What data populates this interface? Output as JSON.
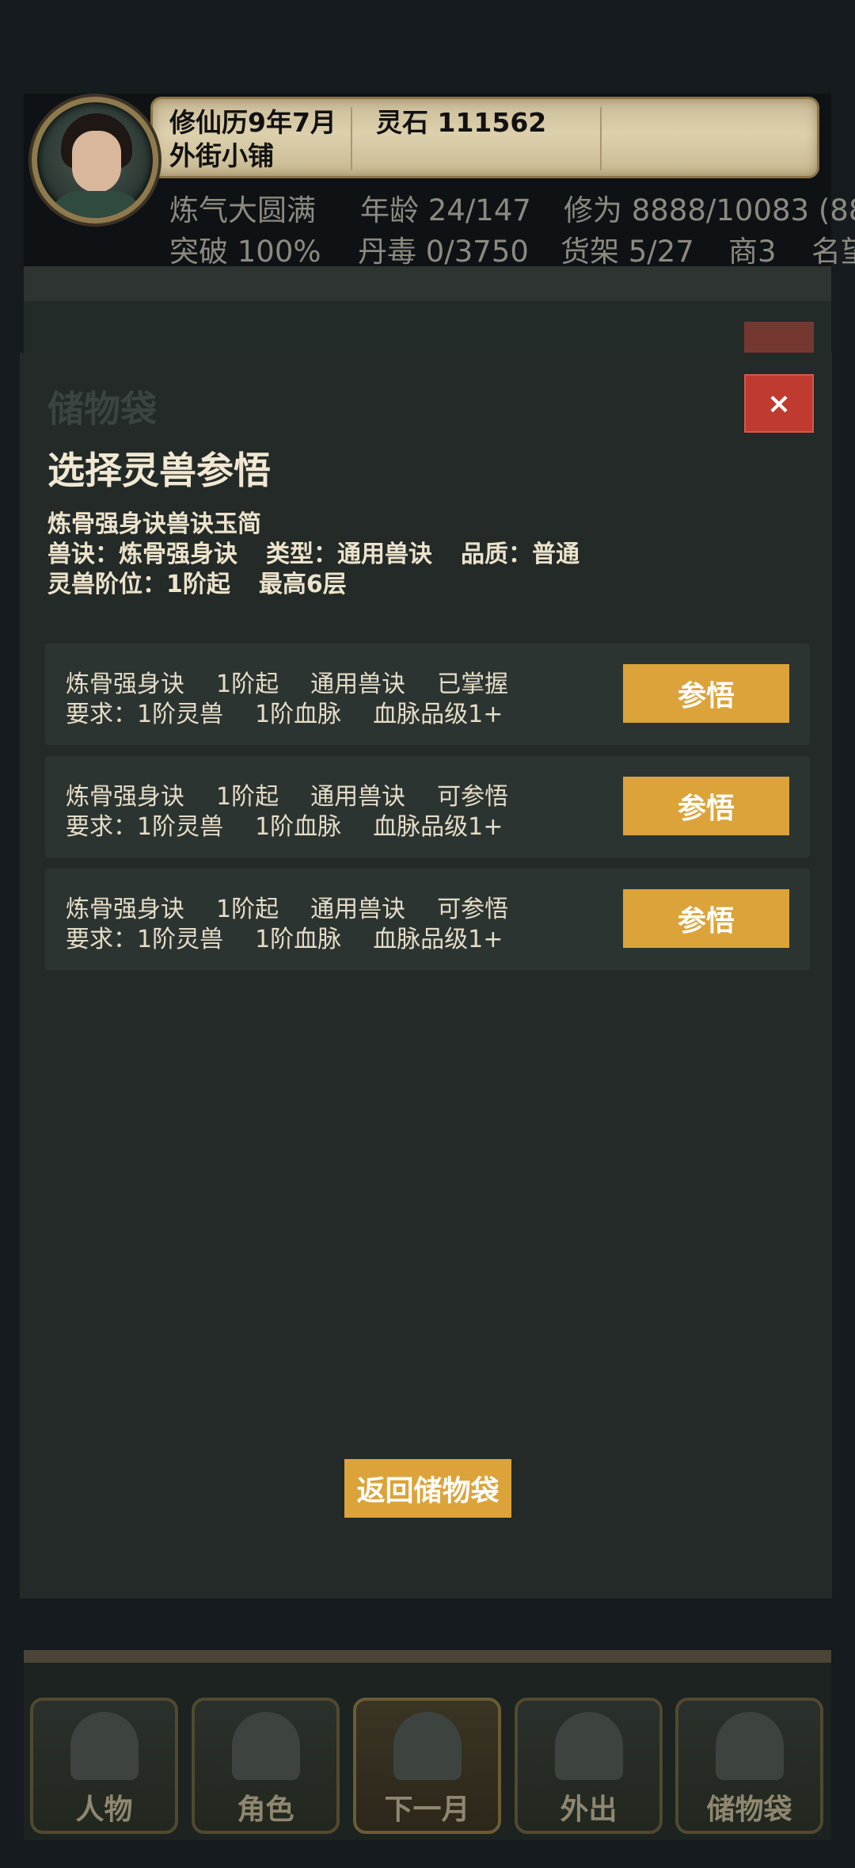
{
  "header": {
    "date": "修仙历9年7月",
    "spirit_stones": "灵石 111562",
    "location": "外街小铺",
    "realm": "炼气大圆满",
    "age": "年龄 24/147",
    "cultivation": "修为 8888/10083 (88",
    "breakthrough": "突破 100%",
    "pill_toxicity": "丹毒 0/3750",
    "shelves": "货架 5/27",
    "merchant": "商3",
    "fame": "名望"
  },
  "dialog": {
    "title": "选择灵兽参悟",
    "close_label": "×",
    "item_name": "炼骨强身诀兽诀玉简",
    "info_technique": "兽诀：炼骨强身诀",
    "info_type": "类型：通用兽诀",
    "info_quality": "品质：普通",
    "info_rank": "灵兽阶位：1阶起",
    "info_max": "最高6层",
    "options": [
      {
        "name": "炼骨强身诀",
        "rank": "1阶起",
        "type": "通用兽诀",
        "status": "已掌握",
        "req_label": "要求：1阶灵兽",
        "req_bloodline": "1阶血脉",
        "req_grade": "血脉品级1+",
        "button": "参悟"
      },
      {
        "name": "炼骨强身诀",
        "rank": "1阶起",
        "type": "通用兽诀",
        "status": "可参悟",
        "req_label": "要求：1阶灵兽",
        "req_bloodline": "1阶血脉",
        "req_grade": "血脉品级1+",
        "button": "参悟"
      },
      {
        "name": "炼骨强身诀",
        "rank": "1阶起",
        "type": "通用兽诀",
        "status": "可参悟",
        "req_label": "要求：1阶灵兽",
        "req_bloodline": "1阶血脉",
        "req_grade": "血脉品级1+",
        "button": "参悟"
      }
    ],
    "back_button": "返回储物袋"
  },
  "background": {
    "bag_title": "储物袋"
  },
  "nav": {
    "items": [
      "人物",
      "角色",
      "下一月",
      "外出",
      "储物袋"
    ]
  },
  "colors": {
    "accent_button": "#dca33a",
    "close_button": "#bf3b30",
    "panel": "#232a27"
  }
}
